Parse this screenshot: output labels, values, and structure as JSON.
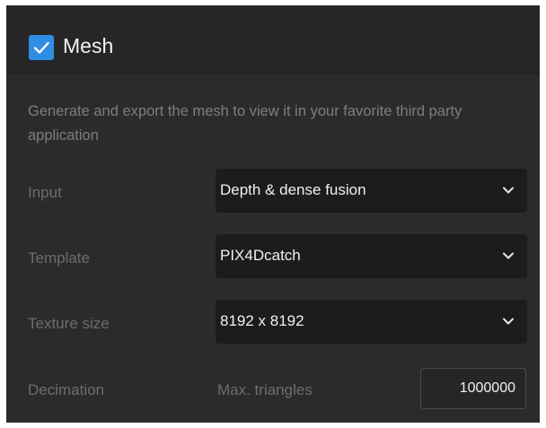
{
  "section": {
    "title": "Mesh",
    "enabled": true,
    "description": "Generate and export the mesh to view it in your favorite third party application"
  },
  "fields": {
    "input": {
      "label": "Input",
      "value": "Depth & dense fusion"
    },
    "template": {
      "label": "Template",
      "value": "PIX4Dcatch"
    },
    "texture_size": {
      "label": "Texture size",
      "value": "8192 x 8192"
    },
    "decimation": {
      "label": "Decimation",
      "sublabel": "Max. triangles",
      "value": "1000000"
    }
  },
  "icons": {
    "checkbox": "checkmark-icon",
    "dropdown": "chevron-down-icon"
  },
  "colors": {
    "accent": "#2f8de4",
    "panel_bg": "#2b2b2b",
    "select_bg": "#1c1c1c"
  }
}
